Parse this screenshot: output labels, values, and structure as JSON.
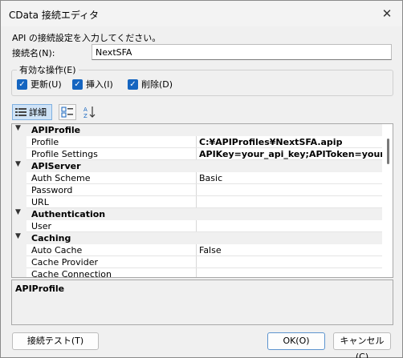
{
  "window": {
    "title": "CData 接続エディタ"
  },
  "intro": "API の接続設定を入力してください。",
  "connection_name": {
    "label": "接続名(N):",
    "value": "NextSFA"
  },
  "operations": {
    "legend": "有効な操作(E)",
    "checkboxes": [
      {
        "label": "更新(U)",
        "checked": true
      },
      {
        "label": "挿入(I)",
        "checked": true
      },
      {
        "label": "削除(D)",
        "checked": true
      }
    ]
  },
  "toolbar": {
    "details_label": "詳細"
  },
  "grid": {
    "categories": [
      {
        "name": "APIProfile",
        "props": [
          {
            "name": "Profile",
            "value": "C:¥APIProfiles¥NextSFA.apip",
            "bold": true
          },
          {
            "name": "Profile Settings",
            "value": "APIKey=your_api_key;APIToken=your_a",
            "bold": true
          }
        ]
      },
      {
        "name": "APIServer",
        "props": [
          {
            "name": "Auth Scheme",
            "value": "Basic",
            "bold": false
          },
          {
            "name": "Password",
            "value": "",
            "bold": false
          },
          {
            "name": "URL",
            "value": "",
            "bold": false
          }
        ]
      },
      {
        "name": "Authentication",
        "props": [
          {
            "name": "User",
            "value": "",
            "bold": false
          }
        ]
      },
      {
        "name": "Caching",
        "props": [
          {
            "name": "Auto Cache",
            "value": "False",
            "bold": false
          },
          {
            "name": "Cache Provider",
            "value": "",
            "bold": false
          },
          {
            "name": "Cache Connection",
            "value": "",
            "bold": false
          }
        ]
      }
    ]
  },
  "description": {
    "title": "APIProfile"
  },
  "buttons": {
    "test": "接続テスト(T)",
    "ok": "OK(O)",
    "cancel": "キャンセル(C)"
  },
  "colors": {
    "accent": "#1565c0",
    "selected_toolbar": "#cfe3f7"
  }
}
